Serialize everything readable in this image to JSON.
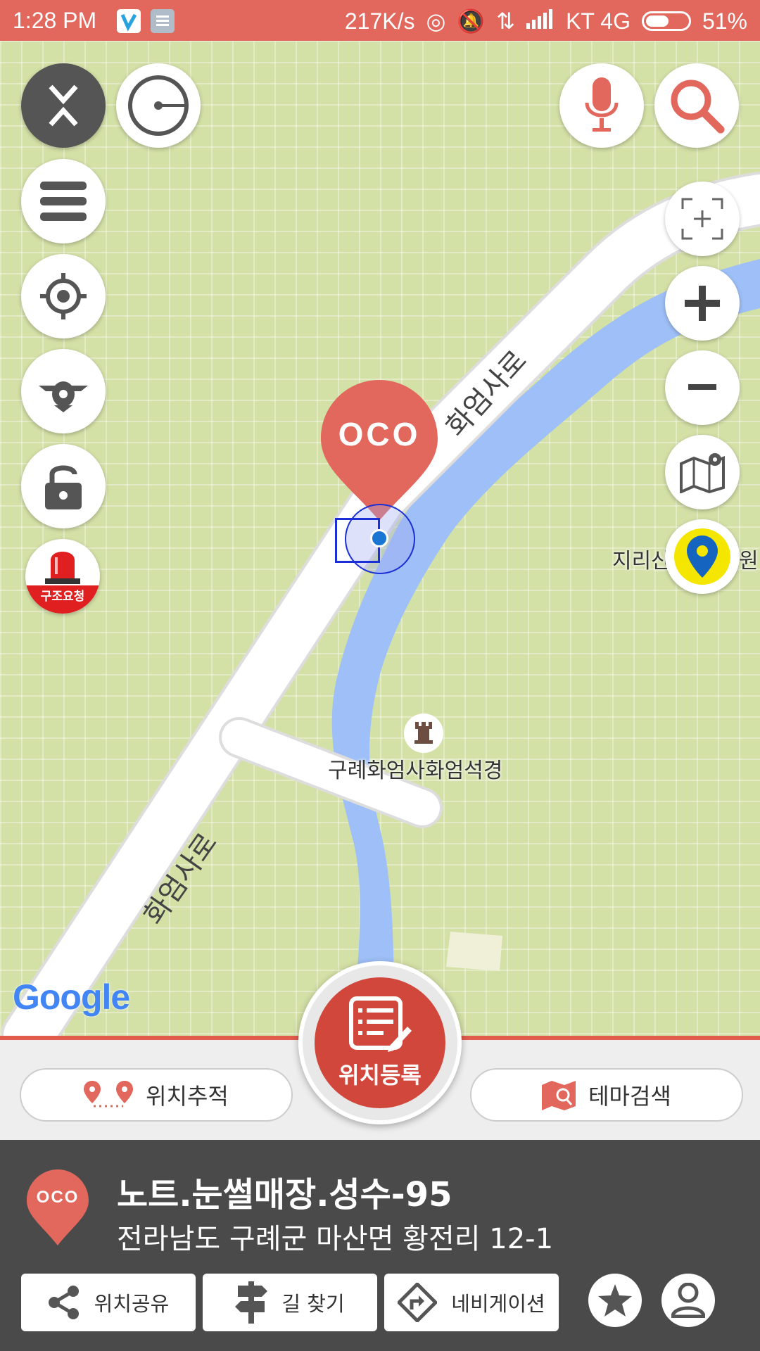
{
  "status_bar": {
    "time": "1:28 PM",
    "speed": "217K/s",
    "carrier": "KT 4G",
    "battery": "51%"
  },
  "map": {
    "road_label_upper": "화엄사로",
    "road_label_lower": "화엄사로",
    "poi_label": "구례화엄사화엄석경",
    "partial_label_left": "지리산",
    "partial_label_right": "원",
    "marker_text": "OCO",
    "google_logo": "Google"
  },
  "left_controls": {
    "rescue_label": "구조요청"
  },
  "action_strip": {
    "track_label": "위치추적",
    "register_label": "위치등록",
    "theme_label": "테마검색"
  },
  "place_panel": {
    "logo_text": "OCO",
    "title": "노트.눈썰매장.성수-95",
    "address": "전라남도 구례군 마산면 황전리 12-1",
    "share_label": "위치공유",
    "route_label": "길 찾기",
    "nav_label": "네비게이션"
  },
  "colors": {
    "accent": "#e2675c",
    "map_bg": "#d3e0a6",
    "river": "#9ebff7",
    "panel_bg": "#4a4a4a"
  }
}
